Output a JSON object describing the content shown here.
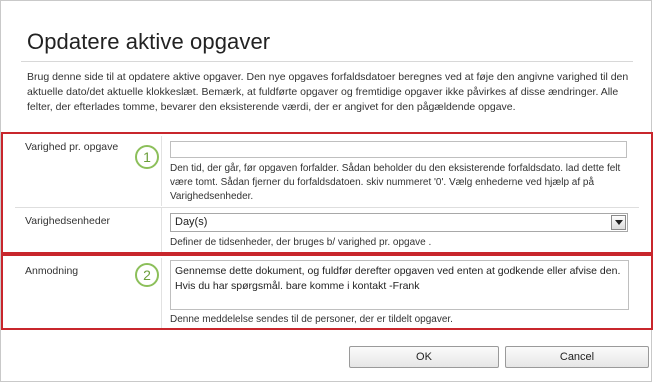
{
  "dialog": {
    "title": "Opdatere aktive opgaver",
    "intro": "Brug denne side til at opdatere aktive opgaver. Den nye opgaves forfaldsdatoer beregnes ved at føje den angivne varighed til den aktuelle dato/det aktuelle klokkeslæt. Bemærk, at fuldførte opgaver og fremtidige opgaver ikke påvirkes af disse ændringer. Alle felter, der efterlades tomme, bevarer den eksisterende værdi, der er angivet for den pågældende opgave."
  },
  "fields": {
    "duration": {
      "label": "Varighed pr. opgave",
      "value": "",
      "help": "Den tid, der går, før opgaven forfalder. Sådan beholder du den eksisterende forfaldsdato. lad dette felt være tomt. Sådan fjerner du forfaldsdatoen. skiv nummeret   '0'. Vælg enhederne ved hjælp af på Varighedsenheder."
    },
    "duration_units": {
      "label": "Varighedsenheder",
      "selected": "Day(s)",
      "help": "Definer de tidsenheder, der bruges b/ varighed pr. opgave ."
    },
    "request": {
      "label": "Anmodning",
      "value": "Gennemse dette dokument, og fuldfør derefter opgaven ved enten at godkende eller afvise den. Hvis du har spørgsmål. bare komme i kontakt -Frank",
      "help": "Denne meddelelse sendes til de personer, der er tildelt opgaver."
    }
  },
  "callouts": {
    "one": "1",
    "two": "2"
  },
  "buttons": {
    "ok": "OK",
    "cancel": "Cancel"
  },
  "colors": {
    "highlight_border": "#c8262c",
    "callout_ring": "#8cbf5a"
  }
}
